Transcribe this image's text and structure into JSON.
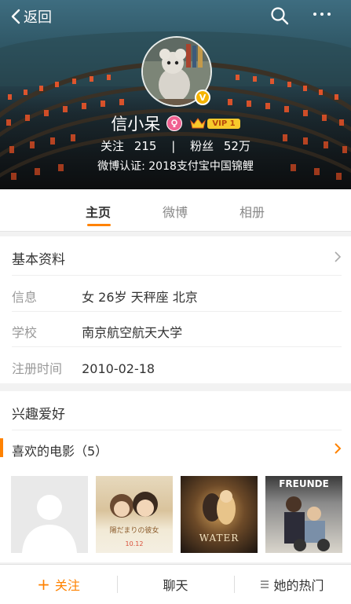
{
  "header": {
    "back_label": "返回",
    "name": "信小呆",
    "vip_label": "VIP 1",
    "stats": {
      "follow_label": "关注",
      "follow_count": "215",
      "divider": "|",
      "fans_label": "粉丝",
      "fans_count": "52万"
    },
    "certification": "微博认证: 2018支付宝中国锦鲤",
    "verified_badge": "V",
    "colors": {
      "accent": "#ff8200",
      "vip": "#f7c92b",
      "female": "#f06292"
    }
  },
  "tabs": [
    {
      "label": "主页",
      "active": true
    },
    {
      "label": "微博",
      "active": false
    },
    {
      "label": "相册",
      "active": false
    }
  ],
  "basic_info": {
    "title": "基本资料",
    "rows": [
      {
        "key": "信息",
        "value": "女  26岁  天秤座  北京"
      },
      {
        "key": "学校",
        "value": "南京航空航天大学"
      },
      {
        "key": "注册时间",
        "value": "2010-02-18"
      }
    ]
  },
  "interests": {
    "title": "兴趣爱好",
    "favorite_movies_label": "喜欢的电影（5）",
    "posters": [
      {
        "title": ""
      },
      {
        "title": "陽だまりの彼女"
      },
      {
        "title": "WATER"
      },
      {
        "title": "FREUNDE"
      }
    ]
  },
  "bottom_bar": {
    "follow_label": "关注",
    "chat_label": "聊天",
    "hot_label": "她的热门"
  }
}
